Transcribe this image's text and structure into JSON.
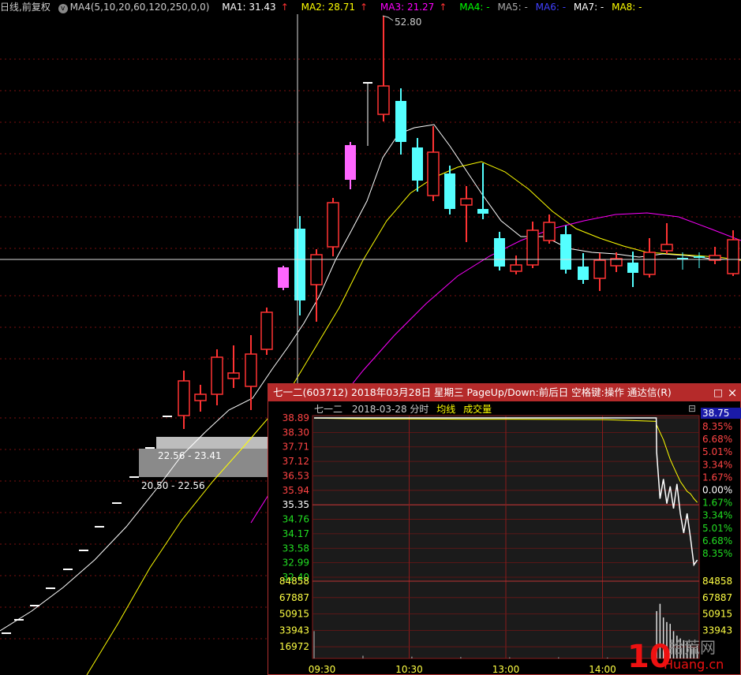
{
  "legend": {
    "chart_mode": "日线,前复权",
    "indicator": "MA4(5,10,20,60,120,250,0,0)",
    "ma1": "MA1: 31.43",
    "ma2": "MA2: 28.71",
    "ma3": "MA3: 21.27",
    "ma4": "MA4: -",
    "ma5": "MA5: -",
    "ma6": "MA6: -",
    "ma7": "MA7: -",
    "ma8": "MA8: -",
    "arrow": "↑",
    "colors": {
      "ma1": "#ffffff",
      "ma2": "#ffff00",
      "ma3": "#ff00ff",
      "ma4": "#00ff00",
      "ma5": "#aaaaaa",
      "ma6": "#4040ff",
      "ma7": "#ffffff",
      "ma8": "#ffff00"
    }
  },
  "kline": {
    "high_label": "52.80",
    "box1_label": "22.56 - 23.41",
    "box2_label": "20.50 - 22.56",
    "up_color": "#ff3333",
    "down_color": "#54ffff",
    "limit_color": "#ff66ff"
  },
  "popup": {
    "title": "七一二(603712) 2018年03月28日 星期三 PageUp/Down:前后日 空格键:操作 通达信(R)",
    "restore_icon": "□",
    "close_icon": "×",
    "sub_name": "七一二",
    "sub_date": "2018-03-28 分时",
    "sub_avg": "均线",
    "sub_vol": "成交量",
    "right_top_value": "38.75",
    "collapse_icon": "⊟",
    "ask_label": "操作"
  },
  "chart_data": {
    "type": "line",
    "title": "七一二 2018-03-28 分时",
    "price_ticks": [
      "38.89",
      "38.30",
      "37.71",
      "37.12",
      "36.53",
      "35.94",
      "35.35",
      "34.76",
      "34.17",
      "33.58",
      "32.99",
      "32.40"
    ],
    "pct_ticks": [
      "8.35%",
      "6.68%",
      "5.01%",
      "3.34%",
      "1.67%",
      "0.00%",
      "1.67%",
      "3.34%",
      "5.01%",
      "6.68%",
      "8.35%"
    ],
    "volume_ticks": [
      "84858",
      "67887",
      "50915",
      "33943",
      "16972"
    ],
    "volume_ticks_right": [
      "84858",
      "67887",
      "50915",
      "33943"
    ],
    "time_ticks": [
      "09:30",
      "10:30",
      "13:00",
      "14:00"
    ],
    "ylim": [
      32.4,
      38.89
    ],
    "prev_close": 35.35,
    "series": [
      {
        "name": "均线",
        "values": [
          38.88,
          38.85,
          38.85,
          38.84,
          38.84,
          38.83,
          38.82,
          38.75,
          38.6,
          38.3,
          38.0,
          37.6,
          37.2,
          36.9,
          36.6,
          36.3,
          36.1,
          35.9,
          35.8,
          35.6,
          35.45
        ]
      },
      {
        "values": [
          38.89,
          38.89,
          38.89,
          38.89,
          38.89,
          38.89,
          38.89,
          38.89,
          37.5,
          35.6,
          36.4,
          35.4,
          36.1,
          35.2,
          36.2,
          35.0,
          34.2,
          35.0,
          34.0,
          32.9,
          33.1
        ]
      }
    ],
    "volume": [
      30000,
      3000,
      2000,
      1500,
      1200,
      1200,
      1000,
      1000,
      52000,
      60000,
      45000,
      40000,
      38000,
      30000,
      25000,
      22000,
      20000,
      18000,
      15000,
      12000,
      14000
    ]
  }
}
